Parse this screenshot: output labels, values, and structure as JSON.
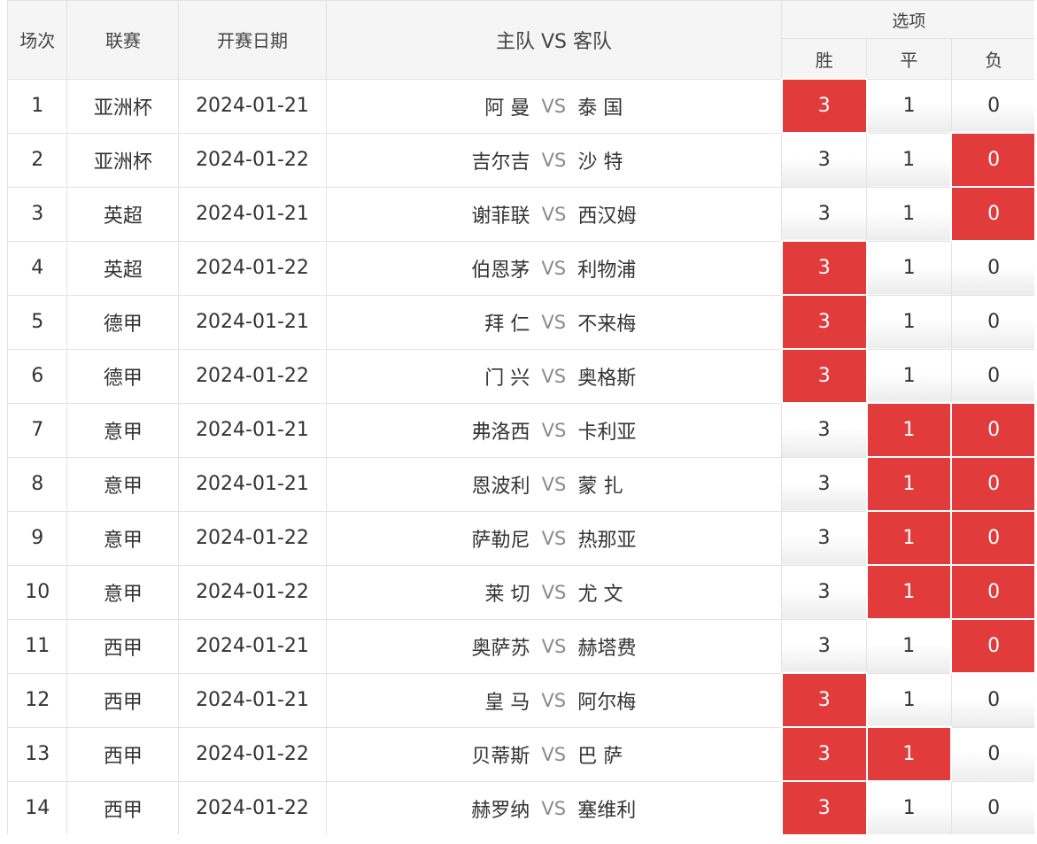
{
  "header": {
    "no": "场次",
    "league": "联赛",
    "date": "开赛日期",
    "match": "主队 VS 客队",
    "options": "选项",
    "win": "胜",
    "draw": "平",
    "lose": "负"
  },
  "vs_label": "VS",
  "highlight_color": "#e23b3b",
  "rows": [
    {
      "no": "1",
      "league": "亚洲杯",
      "date": "2024-01-21",
      "home": "阿 曼",
      "away": "泰 国",
      "win": "3",
      "draw": "1",
      "lose": "0",
      "win_sel": true,
      "draw_sel": false,
      "lose_sel": false
    },
    {
      "no": "2",
      "league": "亚洲杯",
      "date": "2024-01-22",
      "home": "吉尔吉",
      "away": "沙 特",
      "win": "3",
      "draw": "1",
      "lose": "0",
      "win_sel": false,
      "draw_sel": false,
      "lose_sel": true
    },
    {
      "no": "3",
      "league": "英超",
      "date": "2024-01-21",
      "home": "谢菲联",
      "away": "西汉姆",
      "win": "3",
      "draw": "1",
      "lose": "0",
      "win_sel": false,
      "draw_sel": false,
      "lose_sel": true
    },
    {
      "no": "4",
      "league": "英超",
      "date": "2024-01-22",
      "home": "伯恩茅",
      "away": "利物浦",
      "win": "3",
      "draw": "1",
      "lose": "0",
      "win_sel": true,
      "draw_sel": false,
      "lose_sel": false
    },
    {
      "no": "5",
      "league": "德甲",
      "date": "2024-01-21",
      "home": "拜 仁",
      "away": "不来梅",
      "win": "3",
      "draw": "1",
      "lose": "0",
      "win_sel": true,
      "draw_sel": false,
      "lose_sel": false
    },
    {
      "no": "6",
      "league": "德甲",
      "date": "2024-01-22",
      "home": "门 兴",
      "away": "奥格斯",
      "win": "3",
      "draw": "1",
      "lose": "0",
      "win_sel": true,
      "draw_sel": false,
      "lose_sel": false
    },
    {
      "no": "7",
      "league": "意甲",
      "date": "2024-01-21",
      "home": "弗洛西",
      "away": "卡利亚",
      "win": "3",
      "draw": "1",
      "lose": "0",
      "win_sel": false,
      "draw_sel": true,
      "lose_sel": true
    },
    {
      "no": "8",
      "league": "意甲",
      "date": "2024-01-21",
      "home": "恩波利",
      "away": "蒙 扎",
      "win": "3",
      "draw": "1",
      "lose": "0",
      "win_sel": false,
      "draw_sel": true,
      "lose_sel": true
    },
    {
      "no": "9",
      "league": "意甲",
      "date": "2024-01-22",
      "home": "萨勒尼",
      "away": "热那亚",
      "win": "3",
      "draw": "1",
      "lose": "0",
      "win_sel": false,
      "draw_sel": true,
      "lose_sel": true
    },
    {
      "no": "10",
      "league": "意甲",
      "date": "2024-01-22",
      "home": "莱 切",
      "away": "尤 文",
      "win": "3",
      "draw": "1",
      "lose": "0",
      "win_sel": false,
      "draw_sel": true,
      "lose_sel": true
    },
    {
      "no": "11",
      "league": "西甲",
      "date": "2024-01-21",
      "home": "奥萨苏",
      "away": "赫塔费",
      "win": "3",
      "draw": "1",
      "lose": "0",
      "win_sel": false,
      "draw_sel": false,
      "lose_sel": true
    },
    {
      "no": "12",
      "league": "西甲",
      "date": "2024-01-21",
      "home": "皇 马",
      "away": "阿尔梅",
      "win": "3",
      "draw": "1",
      "lose": "0",
      "win_sel": true,
      "draw_sel": false,
      "lose_sel": false
    },
    {
      "no": "13",
      "league": "西甲",
      "date": "2024-01-22",
      "home": "贝蒂斯",
      "away": "巴 萨",
      "win": "3",
      "draw": "1",
      "lose": "0",
      "win_sel": true,
      "draw_sel": true,
      "lose_sel": false
    },
    {
      "no": "14",
      "league": "西甲",
      "date": "2024-01-22",
      "home": "赫罗纳",
      "away": "塞维利",
      "win": "3",
      "draw": "1",
      "lose": "0",
      "win_sel": true,
      "draw_sel": false,
      "lose_sel": false
    }
  ]
}
